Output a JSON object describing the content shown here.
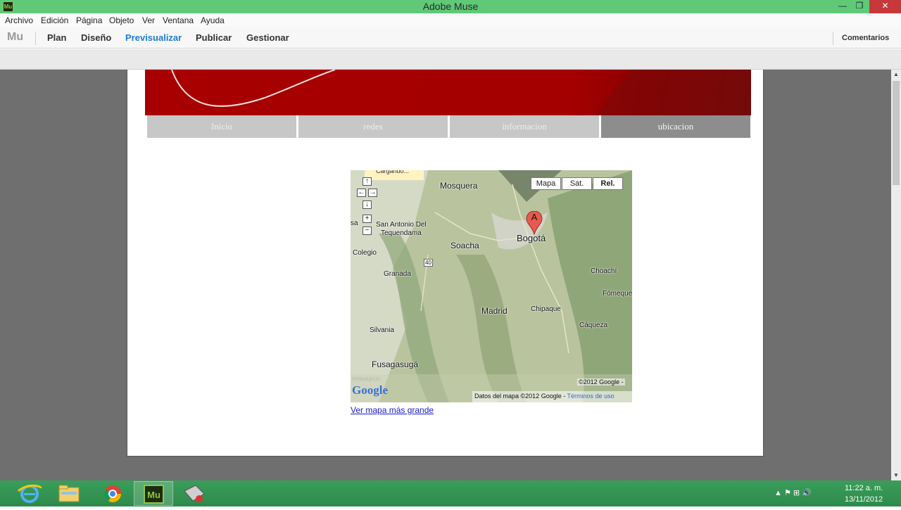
{
  "window": {
    "app_icon_label": "Mu",
    "title": "Adobe Muse",
    "minimize_glyph": "—",
    "restore_glyph": "❐",
    "close_glyph": "✕"
  },
  "menubar": {
    "items": [
      "Archivo",
      "Edición",
      "Página",
      "Objeto",
      "Ver",
      "Ventana",
      "Ayuda"
    ]
  },
  "toolbar": {
    "logo": "Mu",
    "items": [
      "Plan",
      "Diseño",
      "Previsualizar",
      "Publicar",
      "Gestionar"
    ],
    "active_item": "Previsualizar",
    "comments_label": "Comentarios"
  },
  "site": {
    "nav_tabs": [
      "Inicio",
      "redes",
      "informacion",
      "ubicacion"
    ],
    "active_tab": "ubicacion",
    "banner_color": "#a80000"
  },
  "map": {
    "loading_text": "Cargando...",
    "map_types": [
      "Mapa",
      "Sat.",
      "Rel."
    ],
    "marker_label": "A",
    "places": [
      "Mosquera",
      "San Antonio Del",
      "Tequendama",
      "Soacha",
      "Bogotá",
      "Colegio",
      "Granada",
      "Choachí",
      "Fómeque",
      "Madrid",
      "Chipaque",
      "Cáqueza",
      "Silvania",
      "Fusagasugá",
      "sa",
      "40"
    ],
    "powered_by": "POWERED BY",
    "google_logo": "Google",
    "copyright": "©2012 Google -",
    "data_text": "Datos del mapa ©2012 Google - ",
    "terms_text": "Términos de uso",
    "larger_link": "Ver mapa más grande"
  },
  "taskbar": {
    "apps": [
      "internet-explorer",
      "file-explorer",
      "chrome",
      "adobe-muse",
      "other-app"
    ],
    "active_app": "adobe-muse",
    "tray_icons": "▲ ⚑ ⊞ 🔊",
    "time": "11:22 a. m.",
    "date": "13/11/2012"
  }
}
